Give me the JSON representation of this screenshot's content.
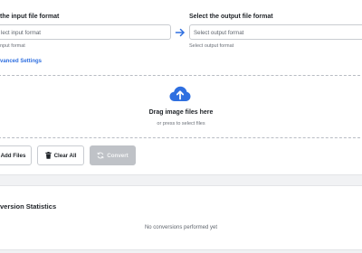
{
  "input_format": {
    "label": "the input file format",
    "placeholder": "lect input format",
    "hint": "nput format"
  },
  "output_format": {
    "label": "Select the output file format",
    "placeholder": "Select output format",
    "hint": "Select output format"
  },
  "swap_icon": "arrow-right-icon",
  "advanced_settings": "vanced Settings",
  "dropzone": {
    "icon": "cloud-upload-icon",
    "title": "Drag image files here",
    "subtitle": "or press to select files"
  },
  "buttons": {
    "add_files": "Add Files",
    "clear_all": "Clear All",
    "convert": "Convert"
  },
  "stats": {
    "title": "version Statistics",
    "empty": "No conversions performed yet"
  },
  "colors": {
    "accent": "#2f6fe0",
    "disabled_button": "#bfc2c7"
  }
}
